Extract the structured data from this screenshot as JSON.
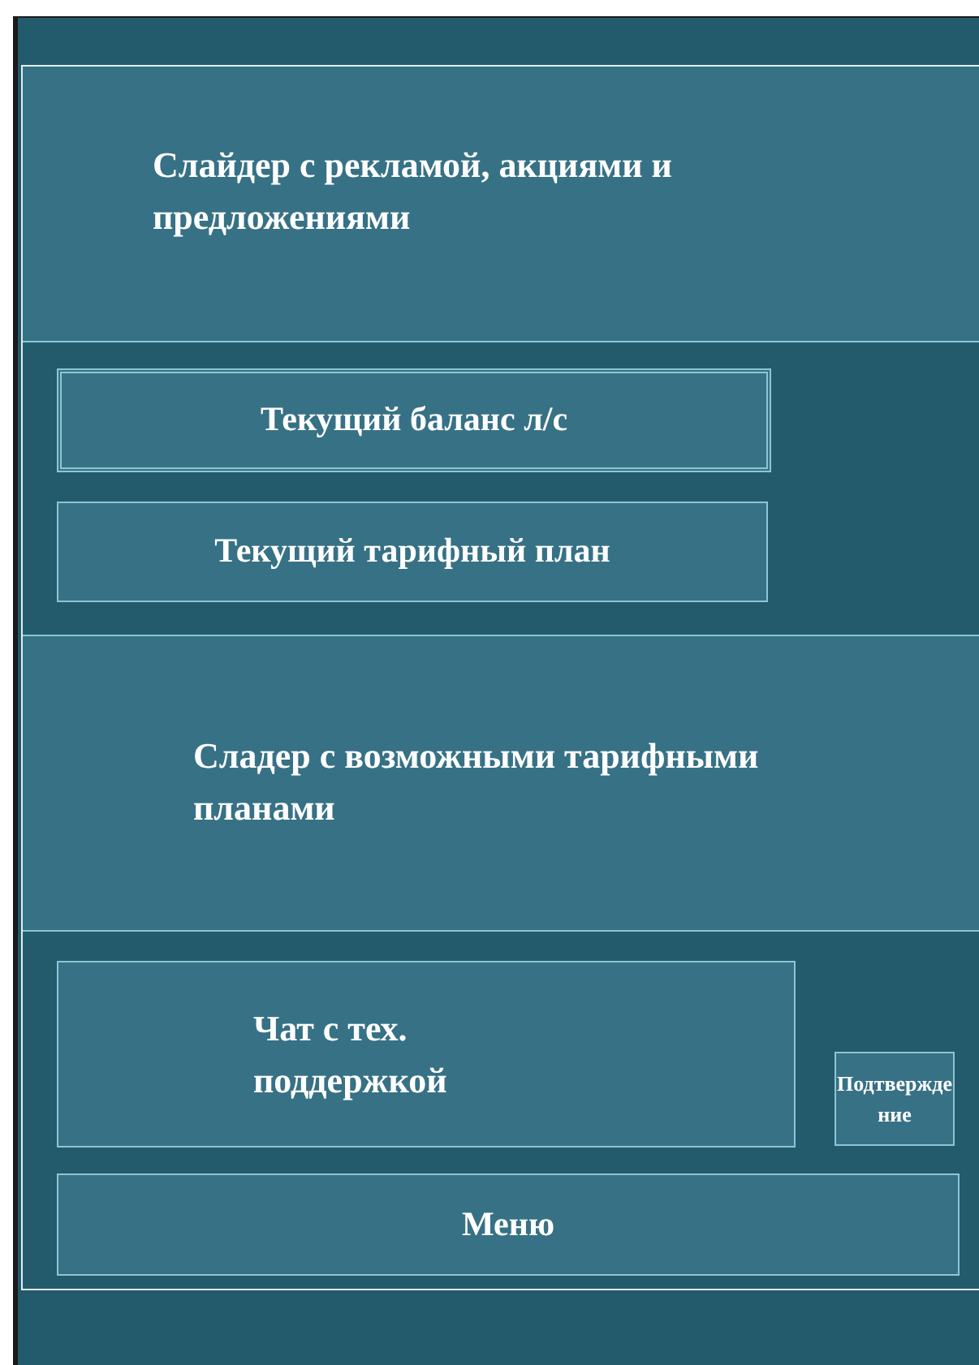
{
  "ads_slider": {
    "text": "Слайдер с рекламой, акциями и предложениями"
  },
  "account": {
    "balance": "Текущий баланс л/с",
    "tariff": "Текущий тарифный план"
  },
  "tariffs_slider": {
    "text": "Сладер с возможными тарифными планами"
  },
  "support": {
    "chat": "Чат с тех. поддержкой",
    "confirm": "Подтверждение",
    "menu": "Меню"
  }
}
